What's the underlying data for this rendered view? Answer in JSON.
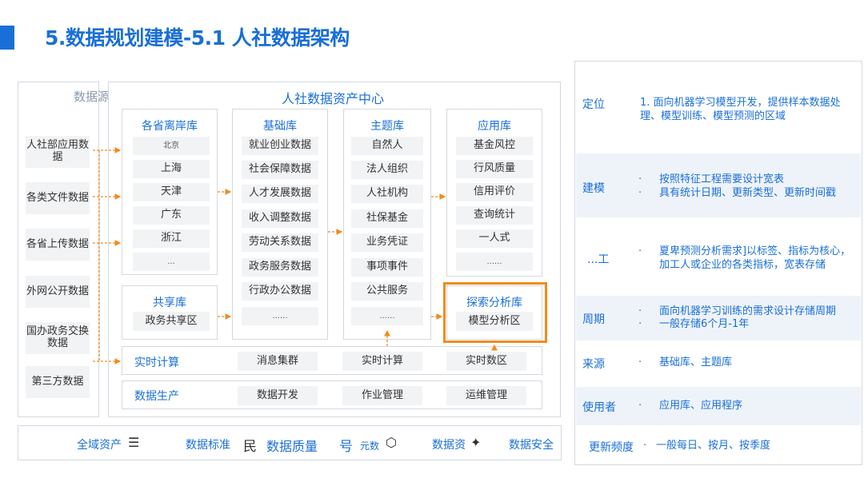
{
  "header": {
    "title": "5.数据规划建模-5.1 人社数据架构"
  },
  "sources": {
    "title": "数据源",
    "items": [
      "人社部应用数据",
      "各类文件数据",
      "各省上传数据",
      "外网公开数据",
      "国办政务交换数据",
      "第三方数据"
    ]
  },
  "center": {
    "title": "人社数据资产中心",
    "provincial": {
      "title": "各省离岸库",
      "items": [
        "北京",
        "上海",
        "天津",
        "广东",
        "浙江",
        "..."
      ]
    },
    "shared": {
      "title": "共享库",
      "items": [
        "政务共享区"
      ]
    },
    "base": {
      "title": "基础库",
      "items": [
        "就业创业数据",
        "社会保障数据",
        "人才发展数据",
        "收入调整数据",
        "劳动关系数据",
        "政务服务数据",
        "行政办公数据",
        "......"
      ]
    },
    "theme": {
      "title": "主题库",
      "items": [
        "自然人",
        "法人组织",
        "人社机构",
        "社保基金",
        "业务凭证",
        "事项事件",
        "公共服务",
        "......"
      ]
    },
    "app": {
      "title": "应用库",
      "items": [
        "基金风控",
        "行风质量",
        "信用评价",
        "查询统计",
        "一人式",
        "......"
      ]
    },
    "explore": {
      "title": "探索分析库",
      "items": [
        "模型分析区"
      ]
    },
    "realtime": {
      "label": "实时计算",
      "items": [
        "消息集群",
        "实时计算",
        "实时数区"
      ]
    },
    "production": {
      "label": "数据生产",
      "items": [
        "数据开发",
        "作业管理",
        "运维管理"
      ]
    }
  },
  "footer": {
    "items": [
      "全域资产",
      "数据标准",
      "民",
      "数据质量",
      "号",
      "元数",
      "数据资",
      "数据安全"
    ]
  },
  "right_panel": {
    "rows": [
      {
        "label": "定位",
        "lines": [
          "1. 面向机器学习模型开发，提供样本数据处",
          "理、模型训练、模型预测的区域"
        ]
      },
      {
        "label": "建模",
        "bullets": [
          "按照特征工程需要设计宽表",
          "具有统计日期、更新类型、更新时间戳"
        ]
      },
      {
        "label": "...工",
        "bullets": [
          "夏卑预测分析需求]以标签、指标为核心，",
          "加工人或企业的各类指标，宽表存储"
        ]
      },
      {
        "label": "周期",
        "bullets": [
          "面向机器学习训练的需求设计存储周期",
          "一般存储6个月-1年"
        ]
      },
      {
        "label": "来源",
        "bullets": [
          "基础库、主题库"
        ]
      },
      {
        "label": "使用者",
        "bullets": [
          "应用库、应用程序"
        ]
      },
      {
        "label": "更新频度",
        "bullets": [
          "一般每日、按月、按季度"
        ]
      }
    ]
  },
  "colors": {
    "accent": "#1a6fd6",
    "highlight": "#f08c1e",
    "arrow": "#f08c1e",
    "cell": "#f2f3f5"
  }
}
